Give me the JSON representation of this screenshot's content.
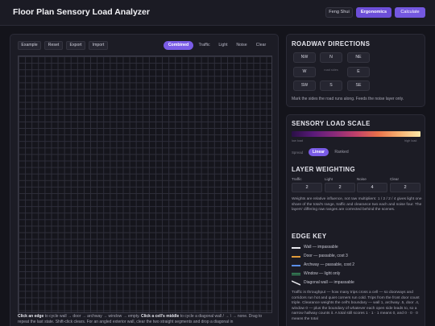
{
  "header": {
    "title": "Floor Plan Sensory Load Analyzer",
    "buttons": {
      "feng_shui": "Feng Shui",
      "ergonomics": "Ergonomics",
      "calculate": "Calculate"
    }
  },
  "toolbar": {
    "actions": {
      "example": "Example",
      "reset": "Reset",
      "export": "Export",
      "import": "Import"
    },
    "modes": {
      "combined": "Combined",
      "traffic": "Traffic",
      "light": "Light",
      "noise": "Noise",
      "clear": "Clear"
    },
    "active_mode": "Combined"
  },
  "help": {
    "bold1": "Click an edge",
    "text1": " to cycle wall → door → archway → window → empty. ",
    "bold2": "Click a cell's middle",
    "text2": " to cycle a diagonal wall / → \\ → none. Drag to repeat the last state. Shift-click clears. For an angled exterior wall, clear the two straight segments and drop a diagonal in"
  },
  "roadway": {
    "title": "ROADWAY DIRECTIONS",
    "directions": {
      "nw": "NW",
      "n": "N",
      "ne": "NE",
      "w": "W",
      "e": "E",
      "sw": "SW",
      "s": "S",
      "se": "SE"
    },
    "center_label": "road sides",
    "note": "Mark the sides the road runs along. Feeds the noise layer only."
  },
  "scale": {
    "title": "SENSORY LOAD SCALE",
    "low_label": "low load",
    "high_label": "high load",
    "mode_label": "Spread",
    "options": {
      "linear": "Linear",
      "ranked": "Ranked"
    },
    "selected": "Linear"
  },
  "weighting": {
    "title": "LAYER WEIGHTING",
    "labels": {
      "traffic": "Traffic",
      "light": "Light",
      "noise": "Noise",
      "clear": "Clear"
    },
    "values": {
      "traffic": "2",
      "light": "2",
      "noise": "4",
      "clear": "2"
    },
    "description": "Weights are relative influence, not raw multipliers: 1 / 2 / 2 / 4 gives light one share of the total's range, traffic and clearance two each and noise four. The layers' differing raw ranges are corrected behind the scenes."
  },
  "edge_key": {
    "title": "EDGE KEY",
    "items": [
      {
        "label": "Wall — impassable",
        "color": "#e8e8ee",
        "style": "solid"
      },
      {
        "label": "Door — passable, cost 3",
        "color": "#e09a3a",
        "style": "solid"
      },
      {
        "label": "Archway — passable, cost 2",
        "color": "#5a8ee8",
        "style": "dashed"
      },
      {
        "label": "Window — light only",
        "color": "#3fa86a",
        "style": "double"
      },
      {
        "label": "Diagonal wall — impassable",
        "color": "#e8e8ee",
        "style": "diagonal"
      }
    ],
    "description": "Traffic is throughput — how many trips cross a cell — so doorways and corridors run hot and quiet corners run cold. Trips from the front door count triple. Clearance weights the cell's boundary — wall 1, archway .5, door .4, window 0 — plus the boundary of whatever each open side leads to, so a narrow hallway counts it. A total still scores 1 · 1 · 1 means 0, and 0 · 0 · 0 means the total"
  },
  "colors": {
    "accent": "#7a5ce6",
    "background": "#14141b",
    "panel": "#1c1c25"
  }
}
